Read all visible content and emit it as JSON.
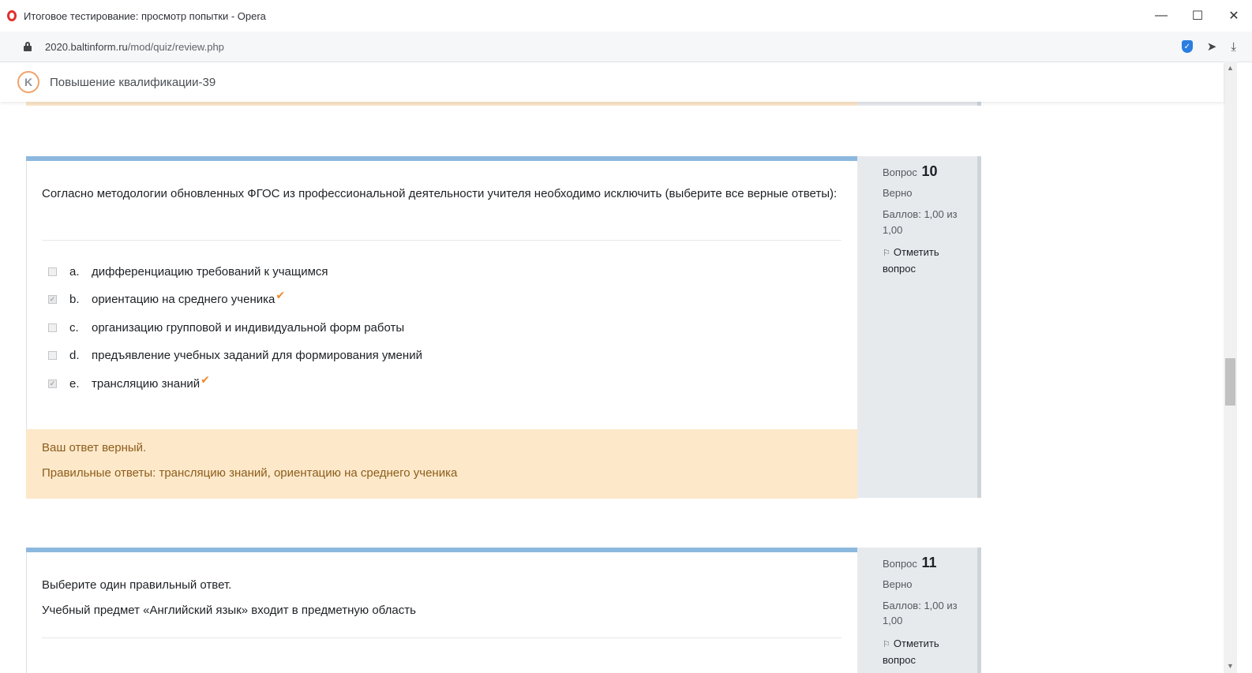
{
  "window": {
    "title": "Итоговое тестирование: просмотр попытки - Opera",
    "controls": {
      "minimize": "—",
      "maximize": "☐",
      "close": "✕"
    }
  },
  "address": {
    "host": "2020.baltinform.ru",
    "path": "/mod/quiz/review.php"
  },
  "site": {
    "logo_letter": "K",
    "name": "Повышение квалификации-39"
  },
  "questions": [
    {
      "label": "Вопрос",
      "number": "10",
      "state": "Верно",
      "grade_line1": "Баллов: 1,00 из",
      "grade_line2": "1,00",
      "flag_line1": "Отметить",
      "flag_line2": "вопрос",
      "text": "Согласно методологии обновленных ФГОС из профессиональной деятельности учителя необходимо исключить (выберите все верные ответы):",
      "answers": [
        {
          "letter": "a.",
          "text": "дифференциацию требований к учащимся",
          "checked": false,
          "correct": false
        },
        {
          "letter": "b.",
          "text": "ориентацию на среднего ученика",
          "checked": true,
          "correct": true
        },
        {
          "letter": "c.",
          "text": "организацию групповой и индивидуальной форм работы",
          "checked": false,
          "correct": false
        },
        {
          "letter": "d.",
          "text": "предъявление учебных заданий для формирования умений",
          "checked": false,
          "correct": false
        },
        {
          "letter": "e.",
          "text": "трансляцию знаний",
          "checked": true,
          "correct": true
        }
      ],
      "feedback": "Ваш ответ верный.",
      "right_answer": "Правильные ответы: трансляцию знаний, ориентацию на среднего ученика"
    },
    {
      "label": "Вопрос",
      "number": "11",
      "state": "Верно",
      "grade_line1": "Баллов: 1,00 из",
      "grade_line2": "1,00",
      "flag_line1": "Отметить",
      "flag_line2": "вопрос",
      "text_line1": "Выберите один правильный ответ.",
      "text_line2": "Учебный предмет «Английский язык» входит в предметную область"
    }
  ],
  "icons": {
    "check": "✓",
    "tick": "✔",
    "flag": "⚐"
  },
  "colors": {
    "accent_bar": "#8db8de",
    "feedback_bg": "#fde8ca",
    "feedback_text": "#8c5e1b",
    "info_bg": "#e7eaed",
    "tick": "#f0882b"
  }
}
